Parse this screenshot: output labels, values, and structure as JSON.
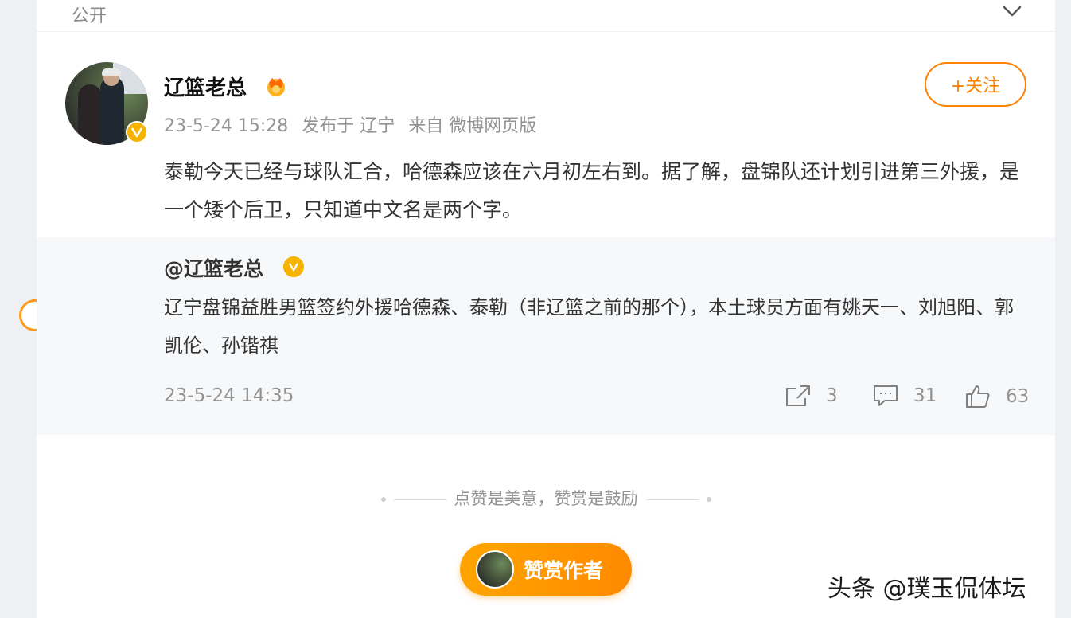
{
  "header": {
    "visibility": "公开",
    "collapse_icon": "chevron-down-icon"
  },
  "post": {
    "author": "辽篮老总",
    "follow_label": "+关注",
    "time": "23-5-24 15:28",
    "location": "发布于 辽宁",
    "source": "来自 微博网页版",
    "text": "泰勒今天已经与球队汇合，哈德森应该在六月初左右到。据了解，盘锦队还计划引进第三外援，是一个矮个后卫，只知道中文名是两个字。"
  },
  "repost": {
    "author": "@辽篮老总",
    "text": "辽宁盘锦益胜男篮签约外援哈德森、泰勒（非辽篮之前的那个），本土球员方面有姚天一、刘旭阳、郭凯伦、孙锴祺",
    "time": "23-5-24 14:35",
    "reposts": "3",
    "comments": "31",
    "likes": "63"
  },
  "reward": {
    "tip": "点赞是美意，赞赏是鼓励",
    "button_label": "赞赏作者"
  },
  "watermark": "头条 @璞玉侃体坛",
  "colors": {
    "accent": "#ff8200",
    "verified": "#f5b400",
    "muted": "#939393"
  }
}
